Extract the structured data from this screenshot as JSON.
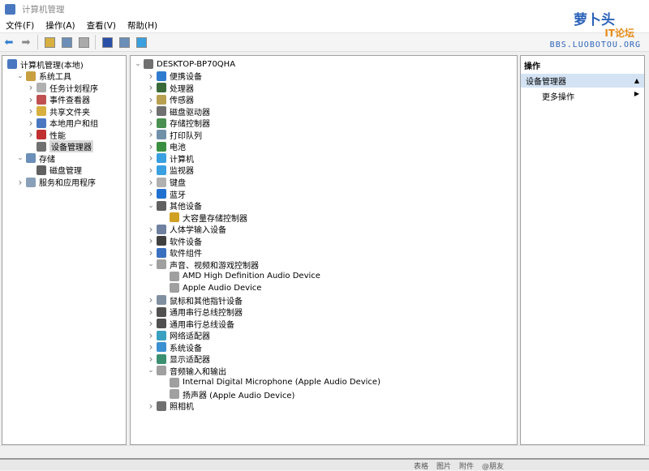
{
  "window": {
    "title": "计算机管理"
  },
  "menu": [
    "文件(F)",
    "操作(A)",
    "查看(V)",
    "帮助(H)"
  ],
  "toolbar": [
    "back-icon",
    "forward-icon",
    "up-icon",
    "show-hide-console-tree-icon",
    "properties-icon",
    "help-icon",
    "show-hide-action-pane-icon",
    "monitor-icon"
  ],
  "left_tree": [
    {
      "label": "计算机管理(本地)",
      "level": 0,
      "chev": "",
      "color": "#4a78c0"
    },
    {
      "label": "系统工具",
      "level": 1,
      "chev": "v",
      "color": "#c8a040"
    },
    {
      "label": "任务计划程序",
      "level": 2,
      "chev": ">",
      "color": "#b0b0b0"
    },
    {
      "label": "事件查看器",
      "level": 2,
      "chev": ">",
      "color": "#c05050"
    },
    {
      "label": "共享文件夹",
      "level": 2,
      "chev": ">",
      "color": "#d8b040"
    },
    {
      "label": "本地用户和组",
      "level": 2,
      "chev": ">",
      "color": "#4a78c0"
    },
    {
      "label": "性能",
      "level": 2,
      "chev": ">",
      "color": "#c03030"
    },
    {
      "label": "设备管理器",
      "level": 2,
      "chev": "",
      "color": "#707070",
      "selected": true
    },
    {
      "label": "存储",
      "level": 1,
      "chev": "v",
      "color": "#6b8fb8"
    },
    {
      "label": "磁盘管理",
      "level": 2,
      "chev": "",
      "color": "#606060"
    },
    {
      "label": "服务和应用程序",
      "level": 1,
      "chev": ">",
      "color": "#8aa0b8"
    }
  ],
  "device_tree": [
    {
      "label": "DESKTOP-BP70QHA",
      "level": 0,
      "chev": "v",
      "color": "#707070"
    },
    {
      "label": "便携设备",
      "level": 1,
      "chev": ">",
      "color": "#2f7bd0"
    },
    {
      "label": "处理器",
      "level": 1,
      "chev": ">",
      "color": "#3a6a3a"
    },
    {
      "label": "传感器",
      "level": 1,
      "chev": ">",
      "color": "#b8a050"
    },
    {
      "label": "磁盘驱动器",
      "level": 1,
      "chev": ">",
      "color": "#707070"
    },
    {
      "label": "存储控制器",
      "level": 1,
      "chev": ">",
      "color": "#4a9050"
    },
    {
      "label": "打印队列",
      "level": 1,
      "chev": ">",
      "color": "#7090a8"
    },
    {
      "label": "电池",
      "level": 1,
      "chev": ">",
      "color": "#3a9040"
    },
    {
      "label": "计算机",
      "level": 1,
      "chev": ">",
      "color": "#3aa0e0"
    },
    {
      "label": "监视器",
      "level": 1,
      "chev": ">",
      "color": "#3aa0e0"
    },
    {
      "label": "键盘",
      "level": 1,
      "chev": ">",
      "color": "#b0b0b0"
    },
    {
      "label": "蓝牙",
      "level": 1,
      "chev": ">",
      "color": "#2070d0"
    },
    {
      "label": "其他设备",
      "level": 1,
      "chev": "v",
      "color": "#606060"
    },
    {
      "label": "大容量存储控制器",
      "level": 2,
      "chev": "",
      "color": "#d0a020"
    },
    {
      "label": "人体学输入设备",
      "level": 1,
      "chev": ">",
      "color": "#7080a0"
    },
    {
      "label": "软件设备",
      "level": 1,
      "chev": ">",
      "color": "#404040"
    },
    {
      "label": "软件组件",
      "level": 1,
      "chev": ">",
      "color": "#3a70c0"
    },
    {
      "label": "声音、视频和游戏控制器",
      "level": 1,
      "chev": "v",
      "color": "#a0a0a0"
    },
    {
      "label": "AMD High Definition Audio Device",
      "level": 2,
      "chev": "",
      "color": "#a0a0a0"
    },
    {
      "label": "Apple Audio Device",
      "level": 2,
      "chev": "",
      "color": "#a0a0a0"
    },
    {
      "label": "鼠标和其他指针设备",
      "level": 1,
      "chev": ">",
      "color": "#8090a0"
    },
    {
      "label": "通用串行总线控制器",
      "level": 1,
      "chev": ">",
      "color": "#505050"
    },
    {
      "label": "通用串行总线设备",
      "level": 1,
      "chev": ">",
      "color": "#505050"
    },
    {
      "label": "网络适配器",
      "level": 1,
      "chev": ">",
      "color": "#3aa0c0"
    },
    {
      "label": "系统设备",
      "level": 1,
      "chev": ">",
      "color": "#3a90d0"
    },
    {
      "label": "显示适配器",
      "level": 1,
      "chev": ">",
      "color": "#3a9070"
    },
    {
      "label": "音频输入和输出",
      "level": 1,
      "chev": "v",
      "color": "#a0a0a0"
    },
    {
      "label": "Internal Digital Microphone (Apple Audio Device)",
      "level": 2,
      "chev": "",
      "color": "#a0a0a0"
    },
    {
      "label": "扬声器 (Apple Audio Device)",
      "level": 2,
      "chev": "",
      "color": "#a0a0a0"
    },
    {
      "label": "照相机",
      "level": 1,
      "chev": ">",
      "color": "#707070"
    }
  ],
  "actions": {
    "header": "操作",
    "section": "设备管理器",
    "more": "更多操作"
  },
  "watermark": {
    "name": "萝卜头",
    "sub": "IT论坛",
    "url": "BBS.LUOBOTOU.ORG"
  },
  "background_taskbar": [
    "表格",
    "图片",
    "附件",
    "@朋友"
  ]
}
